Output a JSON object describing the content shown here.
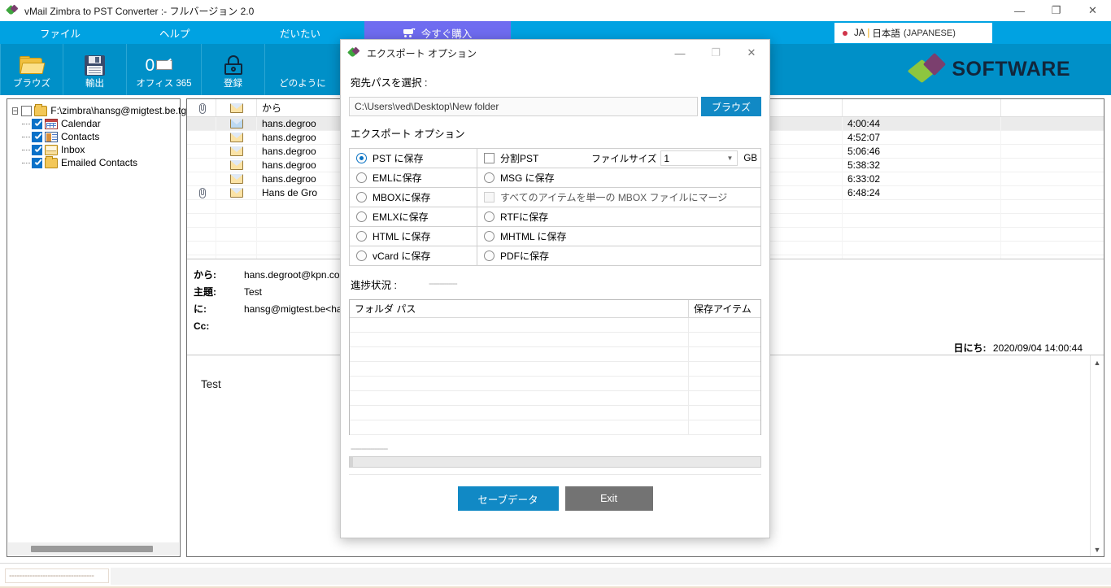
{
  "window": {
    "title": "vMail Zimbra to PST Converter :- フルバージョン 2.0",
    "minimize": "—",
    "maximize": "❐",
    "close": "✕"
  },
  "menu": {
    "items": [
      {
        "label": "ファイル"
      },
      {
        "label": "ヘルプ"
      },
      {
        "label": "だいたい"
      },
      {
        "label": "今すぐ購入"
      }
    ]
  },
  "language": {
    "code": "JA",
    "separator": "|",
    "name": "日本語",
    "english": "(JAPANESE)",
    "dot_color": "#d0344a"
  },
  "toolbar": {
    "items": [
      {
        "label": "ブラウズ",
        "icon": "folder-icon"
      },
      {
        "label": "輸出",
        "icon": "floppy-icon"
      },
      {
        "label": "オフィス 365",
        "icon": "office365-check-icon"
      },
      {
        "label": "登録",
        "icon": "lock-icon"
      },
      {
        "label": "どのように",
        "icon": "how-to-icon"
      }
    ]
  },
  "brand": {
    "text": "SOFTWARE"
  },
  "tree": {
    "root": {
      "label": "F:\\zimbra\\hansg@migtest.be.tgz",
      "checked": false,
      "expander": "−"
    },
    "children": [
      {
        "label": "Calendar",
        "checked": true,
        "icon": "calendar-icon"
      },
      {
        "label": "Contacts",
        "checked": true,
        "icon": "contacts-icon"
      },
      {
        "label": "Inbox",
        "checked": true,
        "icon": "inbox-icon"
      },
      {
        "label": "Emailed Contacts",
        "checked": true,
        "icon": "folder-icon"
      }
    ]
  },
  "mail_list": {
    "columns": [
      {
        "key": "attachment",
        "label": "",
        "icon": "paperclip-icon"
      },
      {
        "key": "status",
        "label": "",
        "icon": "envelope-icon"
      },
      {
        "key": "from",
        "label": "から"
      },
      {
        "key": "subject",
        "label": ""
      },
      {
        "key": "date",
        "label": ""
      }
    ],
    "rows": [
      {
        "attachment": "",
        "from": "hans.degroo",
        "subject": "",
        "date": "4:00:44",
        "selected": true
      },
      {
        "attachment": "",
        "from": "hans.degroo",
        "subject": "",
        "date": "4:52:07",
        "selected": false
      },
      {
        "attachment": "",
        "from": "hans.degroo",
        "subject": "",
        "date": "5:06:46",
        "selected": false
      },
      {
        "attachment": "",
        "from": "hans.degroo",
        "subject": "",
        "date": "5:38:32",
        "selected": false
      },
      {
        "attachment": "",
        "from": "hans.degroo",
        "subject": "",
        "date": "6:33:02",
        "selected": false
      },
      {
        "attachment": "clip",
        "from": "Hans de Gro",
        "subject": "",
        "date": "6:48:24",
        "selected": false
      }
    ]
  },
  "mail_detail": {
    "from_label": "から:",
    "from_value": "hans.degroot@kpn.com<",
    "subject_label": "主題:",
    "subject_value": "Test",
    "to_label": "に:",
    "to_value": "hansg@migtest.be<hansg",
    "cc_label": "Cc:",
    "cc_value": "",
    "date_label": "日にち:",
    "date_value": "2020/09/04 14:00:44",
    "body": "Test"
  },
  "statusbar": {
    "text": "---------------------------------"
  },
  "dialog": {
    "title": "エクスポート オプション",
    "minimize": "—",
    "maximize": "❐",
    "close": "✕",
    "dest_label": "宛先パスを選択 :",
    "dest_path": "C:\\Users\\ved\\Desktop\\New folder",
    "browse_label": "ブラウズ",
    "export_options_label": "エクスポート オプション",
    "options": [
      {
        "left": {
          "label": "PST に保存",
          "type": "radio",
          "selected": true
        },
        "right": {
          "label": "分割PST",
          "type": "checkbox",
          "selected": false,
          "disabled": false
        },
        "filesize_label": "ファイルサイズ",
        "filesize_value": "1",
        "filesize_unit": "GB",
        "filesize_arrow": "▼"
      },
      {
        "left": {
          "label": "EMLに保存",
          "type": "radio",
          "selected": false
        },
        "right": {
          "label": "MSG に保存",
          "type": "radio",
          "selected": false
        }
      },
      {
        "left": {
          "label": "MBOXに保存",
          "type": "radio",
          "selected": false
        },
        "right": {
          "label": "すべてのアイテムを単一の MBOX ファイルにマージ",
          "type": "checkbox",
          "selected": false,
          "disabled": true
        }
      },
      {
        "left": {
          "label": "EMLXに保存",
          "type": "radio",
          "selected": false
        },
        "right": {
          "label": "RTFに保存",
          "type": "radio",
          "selected": false
        }
      },
      {
        "left": {
          "label": "HTML に保存",
          "type": "radio",
          "selected": false
        },
        "right": {
          "label": "MHTML に保存",
          "type": "radio",
          "selected": false
        }
      },
      {
        "left": {
          "label": "vCard に保存",
          "type": "radio",
          "selected": false
        },
        "right": {
          "label": "PDFに保存",
          "type": "radio",
          "selected": false
        }
      }
    ],
    "progress_label": "進捗状況 :",
    "progress_dashes": "-------------",
    "result_table": {
      "col_folder": "フォルダ パス",
      "col_saved": "保存アイテム",
      "rows": []
    },
    "bottom_dashes": "-----------------",
    "progress_value": 0,
    "save_label": "セーブデータ",
    "exit_label": "Exit"
  },
  "colors": {
    "menu_blue": "#00a2e2",
    "toolbar_blue": "#0090c8",
    "buy_purple": "#6f6cf0",
    "accent_blue": "#1189c5",
    "exit_gray": "#737373"
  }
}
